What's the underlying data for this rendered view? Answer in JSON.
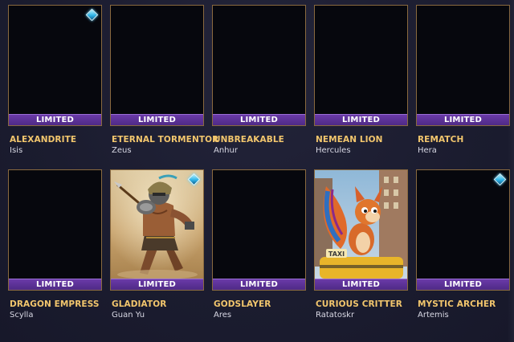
{
  "skins": [
    {
      "title": "ALEXANDRITE",
      "god": "Isis",
      "badge": "LIMITED",
      "has_gem": true,
      "art": "none"
    },
    {
      "title": "ETERNAL TORMENTOR",
      "god": "Zeus",
      "badge": "LIMITED",
      "has_gem": false,
      "art": "none"
    },
    {
      "title": "UNBREAKABLE",
      "god": "Anhur",
      "badge": "LIMITED",
      "has_gem": false,
      "art": "none"
    },
    {
      "title": "NEMEAN LION",
      "god": "Hercules",
      "badge": "LIMITED",
      "has_gem": false,
      "art": "none"
    },
    {
      "title": "REMATCH",
      "god": "Hera",
      "badge": "LIMITED",
      "has_gem": false,
      "art": "none"
    },
    {
      "title": "DRAGON EMPRESS",
      "god": "Scylla",
      "badge": "LIMITED",
      "has_gem": false,
      "art": "none"
    },
    {
      "title": "GLADIATOR",
      "god": "Guan Yu",
      "badge": "LIMITED",
      "has_gem": true,
      "art": "gladiator-warrior-art"
    },
    {
      "title": "GODSLAYER",
      "god": "Ares",
      "badge": "LIMITED",
      "has_gem": false,
      "art": "none"
    },
    {
      "title": "CURIOUS CRITTER",
      "god": "Ratatoskr",
      "badge": "LIMITED",
      "has_gem": false,
      "art": "squirrel-on-taxi-art",
      "art_text": "TAXI"
    },
    {
      "title": "MYSTIC ARCHER",
      "god": "Artemis",
      "badge": "LIMITED",
      "has_gem": true,
      "art": "none"
    }
  ],
  "colors": {
    "background": "#1b1c2f",
    "card_border": "#8a6a3f",
    "limited_banner": "#5a2f96",
    "skin_title": "#f2c66d",
    "god_name": "#d8d8e4",
    "gem": "#2fb4e8"
  }
}
